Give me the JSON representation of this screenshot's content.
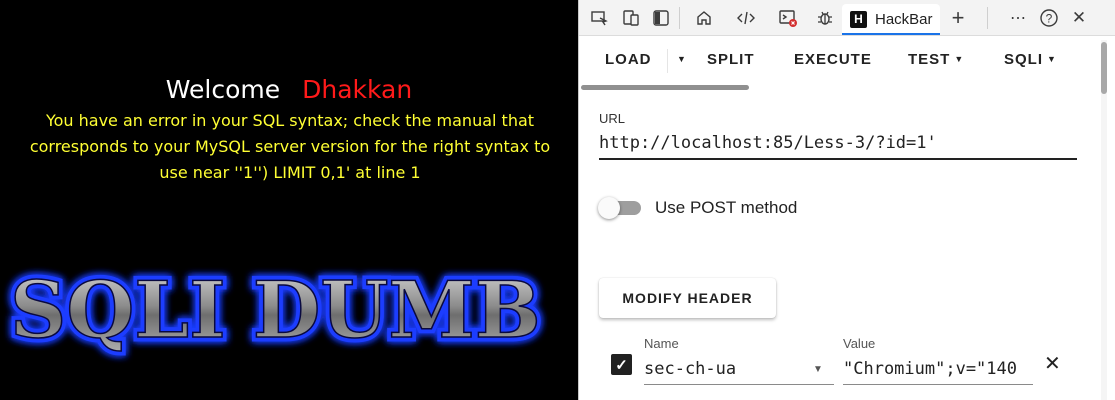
{
  "page": {
    "welcome": "Welcome",
    "username": "Dhakkan",
    "error_message": "You have an error in your SQL syntax; check the manual that corresponds to your MySQL server version for the right syntax to use near ''1'') LIMIT 0,1' at line 1",
    "banner_text": "SQLI DUMB"
  },
  "devtools": {
    "toolbar_icons": [
      "inspect-element-icon",
      "device-emulation-icon",
      "dock-sidebar-icon",
      "welcome-home-icon",
      "elements-code-icon",
      "console-icon",
      "debug-bug-icon"
    ],
    "active_tab": {
      "icon_letter": "H",
      "label": "HackBar"
    },
    "add_tab_icon": "+",
    "more_icon": "⋯",
    "help_icon": "?",
    "close_icon": "✕"
  },
  "hackbar": {
    "menu": {
      "load": "LOAD",
      "split": "SPLIT",
      "execute": "EXECUTE",
      "test": "TEST",
      "sqli": "SQLI"
    },
    "url": {
      "label": "URL",
      "value": "http://localhost:85/Less-3/?id=1'"
    },
    "post_toggle": {
      "label": "Use POST method",
      "enabled": false
    },
    "modify_header_label": "MODIFY HEADER",
    "header_row": {
      "checked": true,
      "name_label": "Name",
      "name_value": "sec-ch-ua",
      "value_label": "Value",
      "value_value": "\"Chromium\";v=\"140"
    }
  },
  "colors": {
    "error_text": "#ffff33",
    "username": "#ff1a1a",
    "banner_glow": "#1f3cff",
    "tab_accent": "#1a73e8"
  }
}
